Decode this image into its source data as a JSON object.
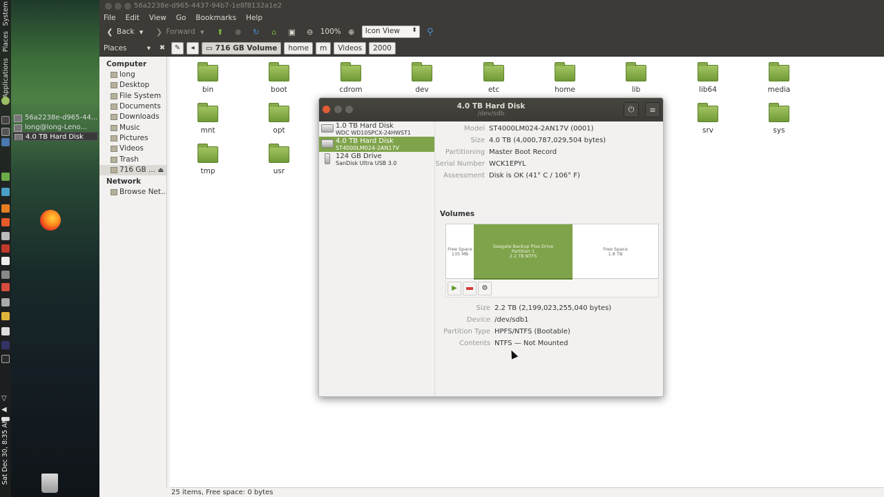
{
  "desktop": {
    "vertical_menu": [
      "System",
      "Places",
      "Applications"
    ],
    "clock": "Sat Dec 30, 8:35 AM",
    "tasks": [
      {
        "label": "56a2238e-d965-44...",
        "active": false
      },
      {
        "label": "long@long-Leno...",
        "active": false
      },
      {
        "label": "4.0 TB Hard Disk",
        "active": true
      }
    ],
    "icons": {
      "firefox": "firefox-icon",
      "trash": "trash-icon"
    }
  },
  "file_manager": {
    "title": "56a2238e-d965-4437-94b7-1e8f8132a1e2",
    "menu": [
      "File",
      "Edit",
      "View",
      "Go",
      "Bookmarks",
      "Help"
    ],
    "toolbar": {
      "back": "Back",
      "forward": "Forward",
      "zoom": "100%",
      "view_mode": "Icon View"
    },
    "location": {
      "places_label": "Places",
      "path": [
        "716 GB Volume",
        "home",
        "m",
        "Videos",
        "2000"
      ]
    },
    "sidebar": {
      "computer_header": "Computer",
      "computer_items": [
        "long",
        "Desktop",
        "File System",
        "Documents",
        "Downloads",
        "Music",
        "Pictures",
        "Videos",
        "Trash",
        "716 GB ..."
      ],
      "network_header": "Network",
      "network_items": [
        "Browse Net..."
      ]
    },
    "folders": [
      [
        "bin",
        "boot",
        "cdrom",
        "dev",
        "etc",
        "home",
        "lib",
        "lib64",
        "media"
      ],
      [
        "mnt",
        "opt",
        "",
        "",
        "",
        "",
        "",
        "srv",
        "sys"
      ],
      [
        "tmp",
        "usr"
      ]
    ],
    "status": "25 items, Free space: 0 bytes"
  },
  "disks": {
    "title": "4.0 TB Hard Disk",
    "subtitle": "/dev/sdb",
    "drives": [
      {
        "name": "1.0 TB Hard Disk",
        "model": "WDC WD10SPCX-24HWST1",
        "selected": false,
        "usb": false
      },
      {
        "name": "4.0 TB Hard Disk",
        "model": "ST4000LM024-2AN17V",
        "selected": true,
        "usb": false
      },
      {
        "name": "124 GB Drive",
        "model": "SanDisk Ultra USB 3.0",
        "selected": false,
        "usb": true
      }
    ],
    "info": [
      {
        "key": "Model",
        "value": "ST4000LM024-2AN17V (0001)"
      },
      {
        "key": "Size",
        "value": "4.0 TB (4,000,787,029,504 bytes)"
      },
      {
        "key": "Partitioning",
        "value": "Master Boot Record"
      },
      {
        "key": "Serial Number",
        "value": "WCK1EPYL"
      },
      {
        "key": "Assessment",
        "value": "Disk is OK (41° C / 106° F)"
      }
    ],
    "volumes_header": "Volumes",
    "volumes": {
      "free1": [
        "Free Space",
        "135 MB"
      ],
      "partition": [
        "Seagate Backup Plus Drive",
        "Partition 1",
        "2.2 TB NTFS"
      ],
      "free2": [
        "Free Space",
        "1.8 TB"
      ]
    },
    "volume_info": [
      {
        "key": "Size",
        "value": "2.2 TB (2,199,023,255,040 bytes)"
      },
      {
        "key": "Device",
        "value": "/dev/sdb1"
      },
      {
        "key": "Partition Type",
        "value": "HPFS/NTFS (Bootable)"
      },
      {
        "key": "Contents",
        "value": "NTFS — Not Mounted"
      }
    ]
  },
  "colors": {
    "accent_green": "#7fa34a",
    "titlebar": "#3c3b37",
    "close_button": "#e25c34"
  }
}
